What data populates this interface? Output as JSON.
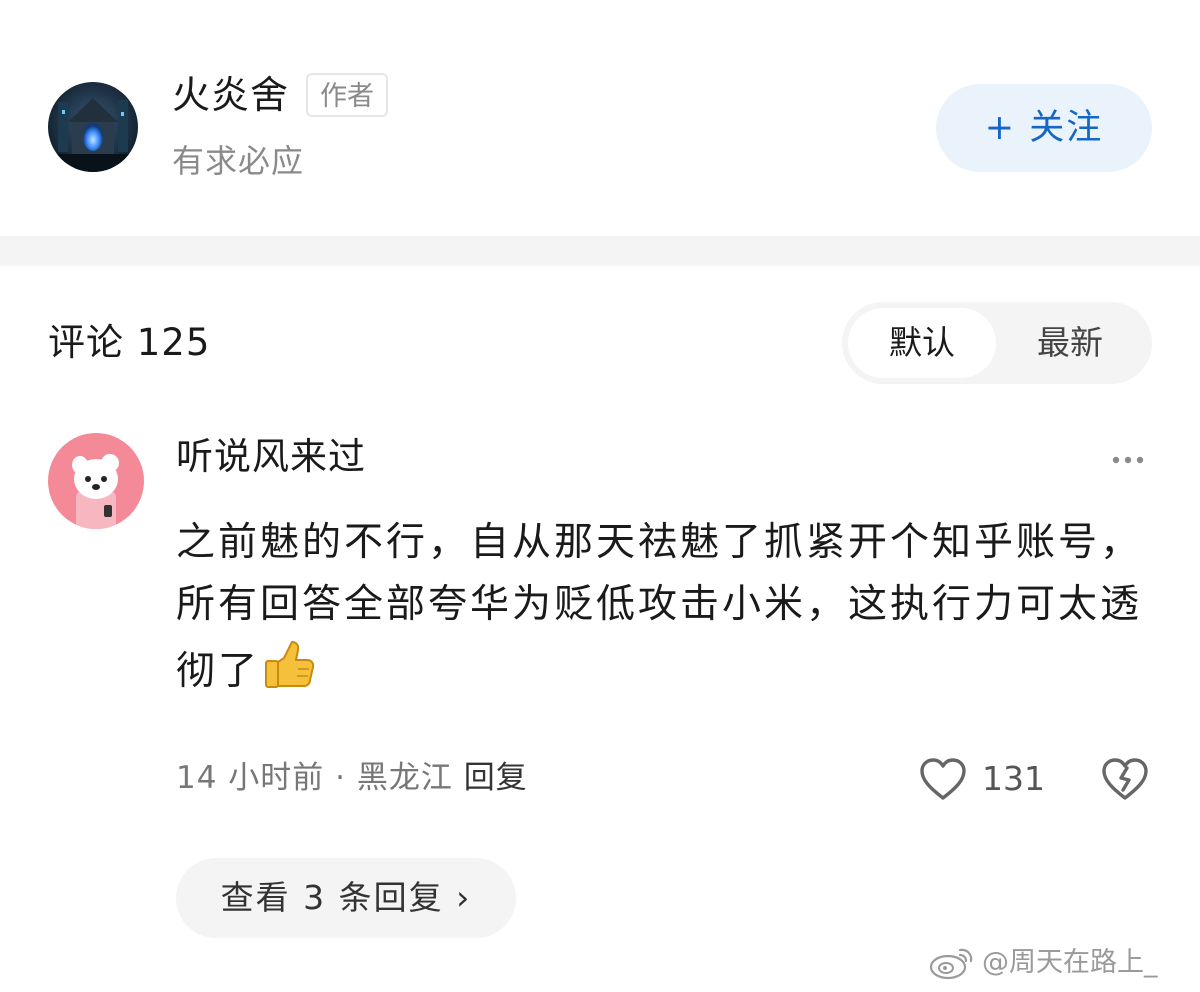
{
  "author": {
    "name": "火炎舍",
    "badge": "作者",
    "tagline": "有求必应",
    "follow_label": "+ 关注"
  },
  "comments": {
    "title": "评论 125",
    "sort_options": [
      "默认",
      "最新"
    ],
    "active_sort": "默认"
  },
  "comment": {
    "user": "听说风来过",
    "text": "之前魅的不行，自从那天祛魅了抓紧开个知乎账号，所有回答全部夸华为贬低攻击小米，这执行力可太透彻了",
    "emoji": "thumbs-up-emoji",
    "time": "14 小时前",
    "separator": " · ",
    "location": "黑龙江",
    "reply_label": "回复",
    "like_count": "131",
    "view_replies_label": "查看 3 条回复 ›"
  },
  "watermark": {
    "text": "@周天在路上_"
  },
  "colors": {
    "accent": "#1466c7",
    "follow_bg": "#eaf2fb",
    "divider": "#f4f4f4",
    "muted_text": "#8a8a8a"
  }
}
